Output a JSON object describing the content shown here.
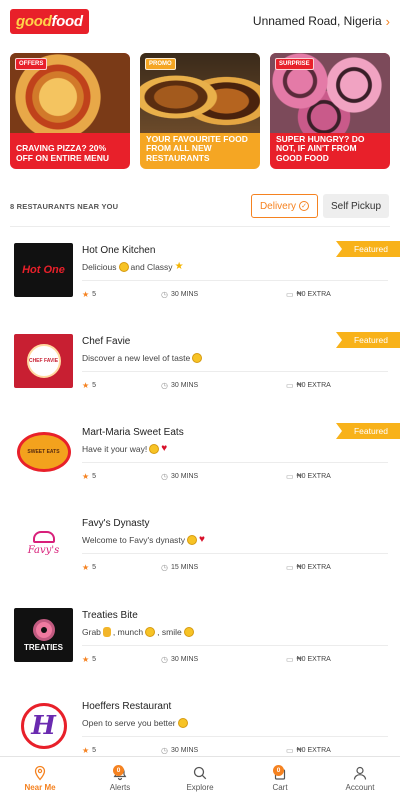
{
  "header": {
    "logo_text_a": "good",
    "logo_text_b": "food",
    "location": "Unnamed Road, Nigeria",
    "chevron": "›"
  },
  "promos": [
    {
      "tag": "OFFERS",
      "text": "CRAVING PIZZA? 20% OFF ON ENTIRE MENU"
    },
    {
      "tag": "PROMO",
      "text": "YOUR FAVOURITE FOOD FROM ALL NEW RESTAURANTS"
    },
    {
      "tag": "SURPRISE",
      "text": "SUPER HUNGRY? DO NOT, IF AIN'T FROM GOOD FOOD"
    }
  ],
  "list_header": {
    "count_label": "8 RESTAURANTS NEAR YOU",
    "delivery_label": "Delivery",
    "pickup_label": "Self Pickup"
  },
  "restaurants": [
    {
      "name": "Hot One Kitchen",
      "desc_a": "Delicious",
      "desc_b": " and Classy",
      "rating": "5",
      "time": "30 MINS",
      "extra": "₦0 EXTRA",
      "featured": "Featured",
      "logo_text": "Hot One"
    },
    {
      "name": "Chef Favie",
      "desc_a": "Discover a new level of taste",
      "desc_b": "",
      "rating": "5",
      "time": "30 MINS",
      "extra": "₦0 EXTRA",
      "featured": "Featured",
      "logo_text": "CHEF FAVIE"
    },
    {
      "name": "Mart-Maria Sweet Eats",
      "desc_a": "Have it your way!",
      "desc_b": "",
      "rating": "5",
      "time": "30 MINS",
      "extra": "₦0 EXTRA",
      "featured": "Featured",
      "logo_text": "SWEET EATS"
    },
    {
      "name": "Favy's Dynasty",
      "desc_a": "Welcome to Favy's dynasty",
      "desc_b": "",
      "rating": "5",
      "time": "15 MINS",
      "extra": "₦0 EXTRA",
      "featured": "",
      "logo_text": "Favy's"
    },
    {
      "name": "Treaties Bite",
      "desc_a": "Grab",
      "desc_b": ", munch",
      "desc_c": ", smile",
      "rating": "5",
      "time": "30 MINS",
      "extra": "₦0 EXTRA",
      "featured": "",
      "logo_text": "TREATIES"
    },
    {
      "name": "Hoeffers Restaurant",
      "desc_a": "Open to serve you better",
      "desc_b": "",
      "rating": "5",
      "time": "30 MINS",
      "extra": "₦0 EXTRA",
      "featured": "",
      "logo_text": "H"
    }
  ],
  "nav": [
    {
      "label": "Near Me",
      "icon": "location-pin-icon",
      "badge": ""
    },
    {
      "label": "Alerts",
      "icon": "bell-icon",
      "badge": "0"
    },
    {
      "label": "Explore",
      "icon": "search-icon",
      "badge": ""
    },
    {
      "label": "Cart",
      "icon": "cart-icon",
      "badge": "0"
    },
    {
      "label": "Account",
      "icon": "user-icon",
      "badge": ""
    }
  ],
  "colors": {
    "brand_red": "#e8202a",
    "accent_orange": "#f58220",
    "featured_yellow": "#f8b21a"
  }
}
